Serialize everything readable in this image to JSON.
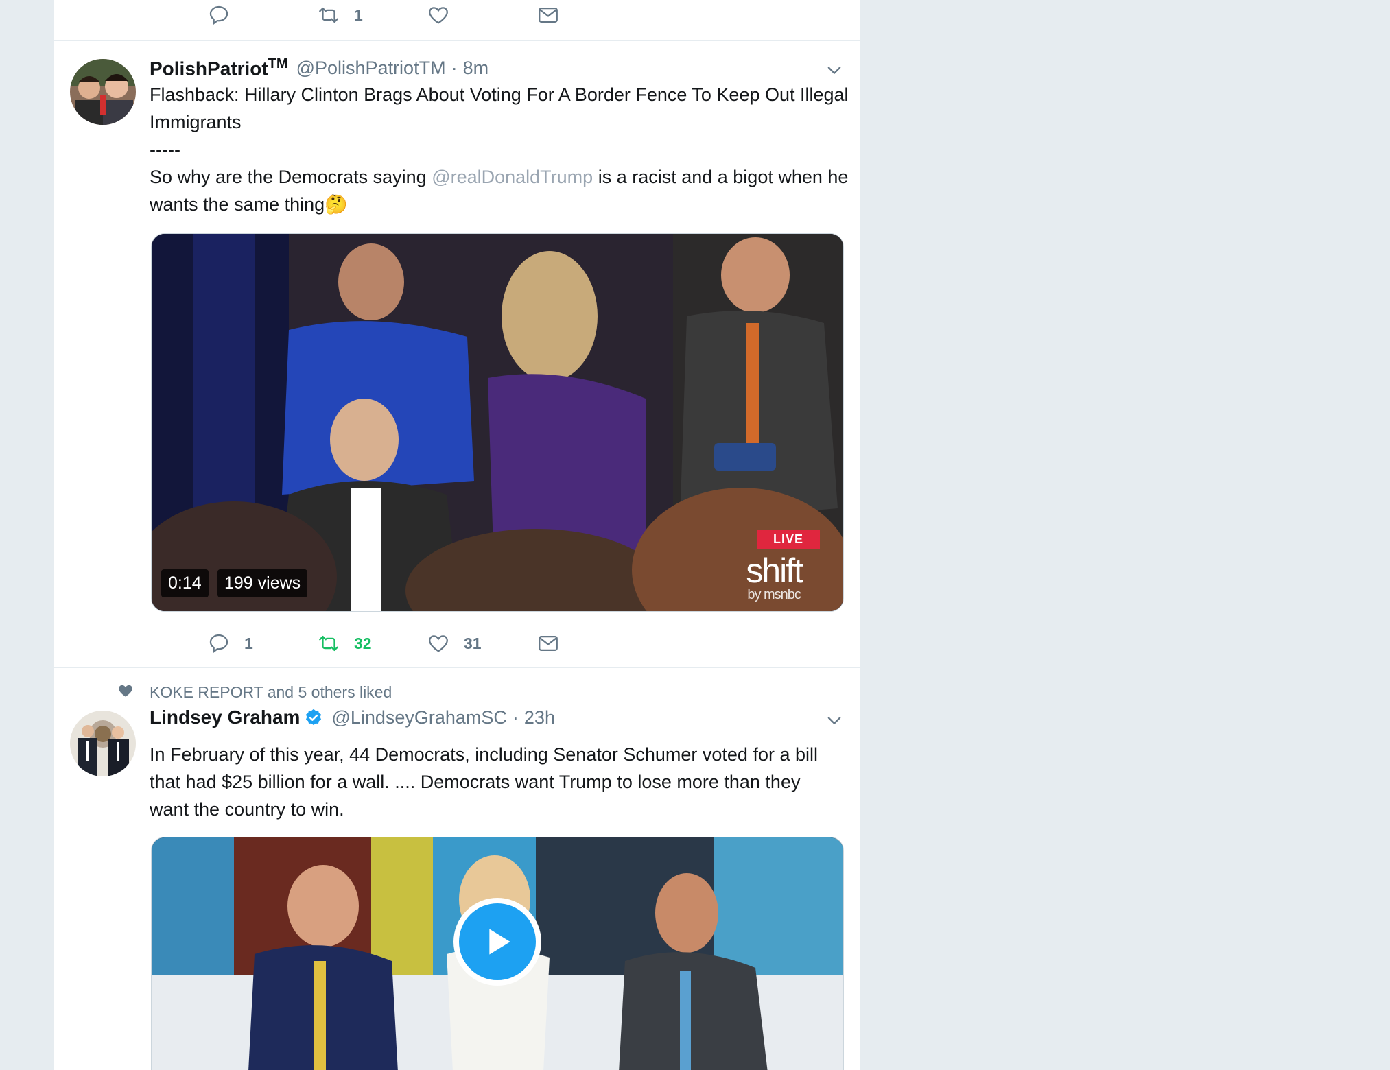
{
  "top_actions": {
    "reply_count": "",
    "retweet_count": "1",
    "like_count": ""
  },
  "tweets": [
    {
      "name": "PolishPatriot",
      "name_suffix": "TM",
      "handle": "@PolishPatriotTM",
      "separator": "·",
      "time": "8m",
      "text_line1": "Flashback: Hillary Clinton Brags About Voting For A Border Fence To Keep Out Illegal Immigrants",
      "text_dashes": "-----",
      "text_part_a": "So why are the Democrats saying ",
      "mention": "@realDonaldTrump",
      "text_part_b": " is a racist and a bigot when he wants the same thing",
      "emoji": "🤔",
      "video_duration": "0:14",
      "video_views": "199 views",
      "live_label": "LIVE",
      "logo_big": "shift",
      "logo_small": "by msnbc",
      "reply_count": "1",
      "retweet_count": "32",
      "like_count": "31"
    },
    {
      "social_context": "KOKE REPORT and 5 others liked",
      "name": "Lindsey Graham",
      "handle": "@LindseyGrahamSC",
      "separator": "·",
      "time": "23h",
      "text": "In February of this year, 44 Democrats, including Senator Schumer voted for a bill that had $25 billion for a wall. .... Democrats want Trump to lose more than they want the country to win."
    }
  ],
  "colors": {
    "background": "#e6ecf0",
    "retweet_active": "#17bf63",
    "accent_blue": "#1da1f2",
    "muted_text": "#657786"
  }
}
